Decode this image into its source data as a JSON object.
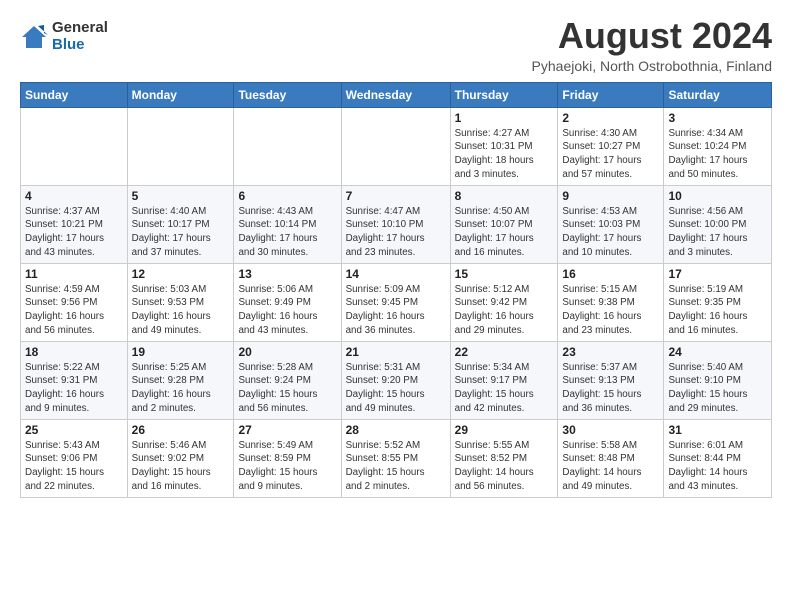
{
  "logo": {
    "general": "General",
    "blue": "Blue"
  },
  "title": "August 2024",
  "location": "Pyhaejoki, North Ostrobothnia, Finland",
  "days_of_week": [
    "Sunday",
    "Monday",
    "Tuesday",
    "Wednesday",
    "Thursday",
    "Friday",
    "Saturday"
  ],
  "weeks": [
    [
      {
        "day": "",
        "info": ""
      },
      {
        "day": "",
        "info": ""
      },
      {
        "day": "",
        "info": ""
      },
      {
        "day": "",
        "info": ""
      },
      {
        "day": "1",
        "info": "Sunrise: 4:27 AM\nSunset: 10:31 PM\nDaylight: 18 hours\nand 3 minutes."
      },
      {
        "day": "2",
        "info": "Sunrise: 4:30 AM\nSunset: 10:27 PM\nDaylight: 17 hours\nand 57 minutes."
      },
      {
        "day": "3",
        "info": "Sunrise: 4:34 AM\nSunset: 10:24 PM\nDaylight: 17 hours\nand 50 minutes."
      }
    ],
    [
      {
        "day": "4",
        "info": "Sunrise: 4:37 AM\nSunset: 10:21 PM\nDaylight: 17 hours\nand 43 minutes."
      },
      {
        "day": "5",
        "info": "Sunrise: 4:40 AM\nSunset: 10:17 PM\nDaylight: 17 hours\nand 37 minutes."
      },
      {
        "day": "6",
        "info": "Sunrise: 4:43 AM\nSunset: 10:14 PM\nDaylight: 17 hours\nand 30 minutes."
      },
      {
        "day": "7",
        "info": "Sunrise: 4:47 AM\nSunset: 10:10 PM\nDaylight: 17 hours\nand 23 minutes."
      },
      {
        "day": "8",
        "info": "Sunrise: 4:50 AM\nSunset: 10:07 PM\nDaylight: 17 hours\nand 16 minutes."
      },
      {
        "day": "9",
        "info": "Sunrise: 4:53 AM\nSunset: 10:03 PM\nDaylight: 17 hours\nand 10 minutes."
      },
      {
        "day": "10",
        "info": "Sunrise: 4:56 AM\nSunset: 10:00 PM\nDaylight: 17 hours\nand 3 minutes."
      }
    ],
    [
      {
        "day": "11",
        "info": "Sunrise: 4:59 AM\nSunset: 9:56 PM\nDaylight: 16 hours\nand 56 minutes."
      },
      {
        "day": "12",
        "info": "Sunrise: 5:03 AM\nSunset: 9:53 PM\nDaylight: 16 hours\nand 49 minutes."
      },
      {
        "day": "13",
        "info": "Sunrise: 5:06 AM\nSunset: 9:49 PM\nDaylight: 16 hours\nand 43 minutes."
      },
      {
        "day": "14",
        "info": "Sunrise: 5:09 AM\nSunset: 9:45 PM\nDaylight: 16 hours\nand 36 minutes."
      },
      {
        "day": "15",
        "info": "Sunrise: 5:12 AM\nSunset: 9:42 PM\nDaylight: 16 hours\nand 29 minutes."
      },
      {
        "day": "16",
        "info": "Sunrise: 5:15 AM\nSunset: 9:38 PM\nDaylight: 16 hours\nand 23 minutes."
      },
      {
        "day": "17",
        "info": "Sunrise: 5:19 AM\nSunset: 9:35 PM\nDaylight: 16 hours\nand 16 minutes."
      }
    ],
    [
      {
        "day": "18",
        "info": "Sunrise: 5:22 AM\nSunset: 9:31 PM\nDaylight: 16 hours\nand 9 minutes."
      },
      {
        "day": "19",
        "info": "Sunrise: 5:25 AM\nSunset: 9:28 PM\nDaylight: 16 hours\nand 2 minutes."
      },
      {
        "day": "20",
        "info": "Sunrise: 5:28 AM\nSunset: 9:24 PM\nDaylight: 15 hours\nand 56 minutes."
      },
      {
        "day": "21",
        "info": "Sunrise: 5:31 AM\nSunset: 9:20 PM\nDaylight: 15 hours\nand 49 minutes."
      },
      {
        "day": "22",
        "info": "Sunrise: 5:34 AM\nSunset: 9:17 PM\nDaylight: 15 hours\nand 42 minutes."
      },
      {
        "day": "23",
        "info": "Sunrise: 5:37 AM\nSunset: 9:13 PM\nDaylight: 15 hours\nand 36 minutes."
      },
      {
        "day": "24",
        "info": "Sunrise: 5:40 AM\nSunset: 9:10 PM\nDaylight: 15 hours\nand 29 minutes."
      }
    ],
    [
      {
        "day": "25",
        "info": "Sunrise: 5:43 AM\nSunset: 9:06 PM\nDaylight: 15 hours\nand 22 minutes."
      },
      {
        "day": "26",
        "info": "Sunrise: 5:46 AM\nSunset: 9:02 PM\nDaylight: 15 hours\nand 16 minutes."
      },
      {
        "day": "27",
        "info": "Sunrise: 5:49 AM\nSunset: 8:59 PM\nDaylight: 15 hours\nand 9 minutes."
      },
      {
        "day": "28",
        "info": "Sunrise: 5:52 AM\nSunset: 8:55 PM\nDaylight: 15 hours\nand 2 minutes."
      },
      {
        "day": "29",
        "info": "Sunrise: 5:55 AM\nSunset: 8:52 PM\nDaylight: 14 hours\nand 56 minutes."
      },
      {
        "day": "30",
        "info": "Sunrise: 5:58 AM\nSunset: 8:48 PM\nDaylight: 14 hours\nand 49 minutes."
      },
      {
        "day": "31",
        "info": "Sunrise: 6:01 AM\nSunset: 8:44 PM\nDaylight: 14 hours\nand 43 minutes."
      }
    ]
  ]
}
